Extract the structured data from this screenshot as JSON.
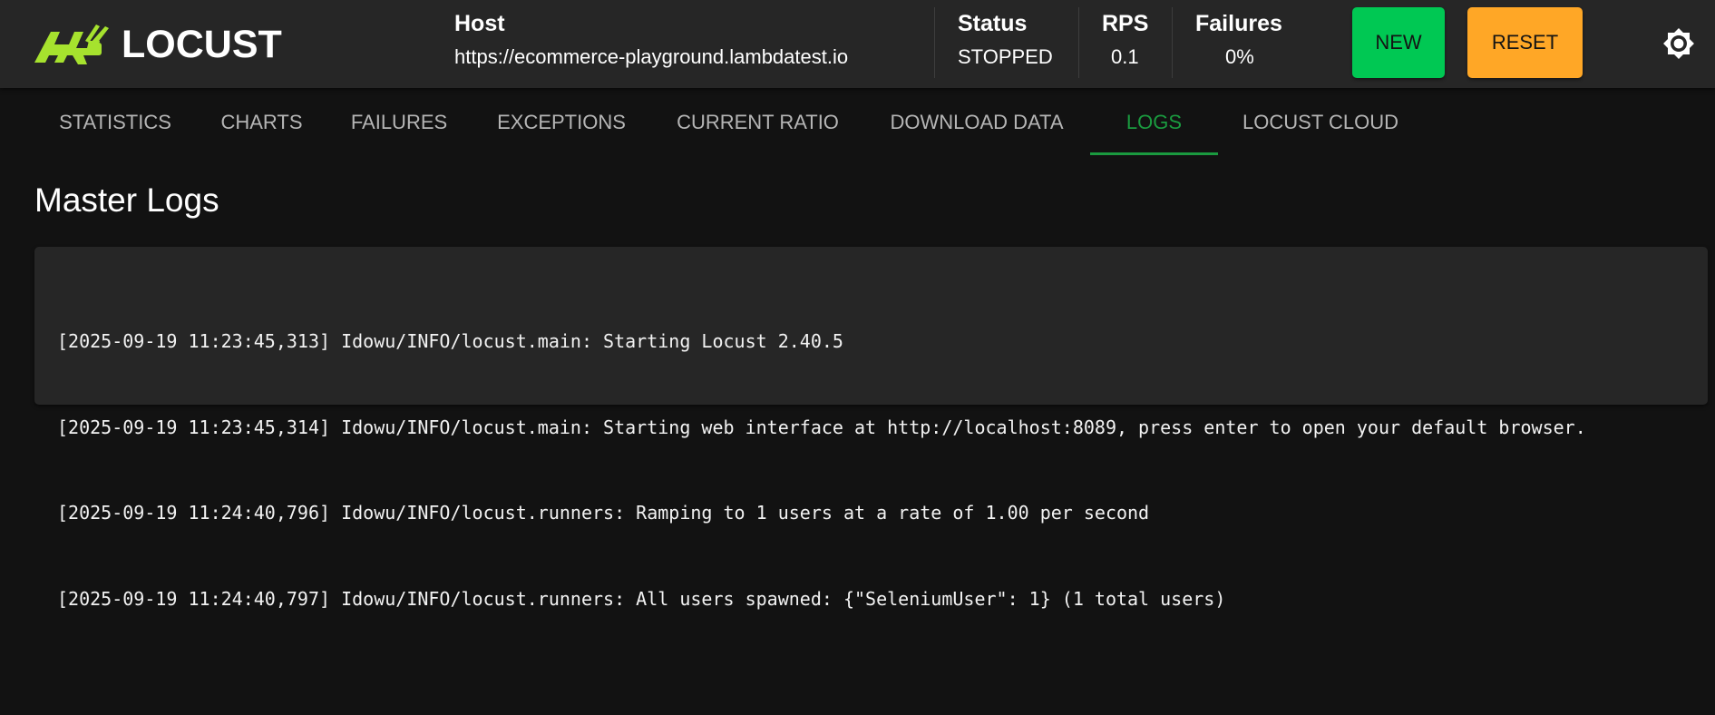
{
  "app": {
    "name": "LOCUST"
  },
  "header": {
    "host": {
      "label": "Host",
      "value": "https://ecommerce-playground.lambdatest.io"
    },
    "status": {
      "label": "Status",
      "value": "STOPPED"
    },
    "rps": {
      "label": "RPS",
      "value": "0.1"
    },
    "failures": {
      "label": "Failures",
      "value": "0%"
    },
    "new_label": "NEW",
    "reset_label": "RESET",
    "theme_icon": "brightness-icon"
  },
  "tabs": [
    {
      "label": "STATISTICS",
      "active": false
    },
    {
      "label": "CHARTS",
      "active": false
    },
    {
      "label": "FAILURES",
      "active": false
    },
    {
      "label": "EXCEPTIONS",
      "active": false
    },
    {
      "label": "CURRENT RATIO",
      "active": false
    },
    {
      "label": "DOWNLOAD DATA",
      "active": false
    },
    {
      "label": "LOGS",
      "active": true
    },
    {
      "label": "LOCUST CLOUD",
      "active": false
    }
  ],
  "main": {
    "title": "Master Logs",
    "logs": [
      "[2025-09-19 11:23:45,313] Idowu/INFO/locust.main: Starting Locust 2.40.5",
      "[2025-09-19 11:23:45,314] Idowu/INFO/locust.main: Starting web interface at http://localhost:8089, press enter to open your default browser.",
      "[2025-09-19 11:24:40,796] Idowu/INFO/locust.runners: Ramping to 1 users at a rate of 1.00 per second",
      "[2025-09-19 11:24:40,797] Idowu/INFO/locust.runners: All users spawned: {\"SeleniumUser\": 1} (1 total users)"
    ]
  },
  "colors": {
    "background": "#121212",
    "header": "#262626",
    "accent_green": "#00c853",
    "accent_orange": "#ffa726",
    "logo_green": "#a6e22e",
    "active_tab": "#1a9a3f"
  }
}
